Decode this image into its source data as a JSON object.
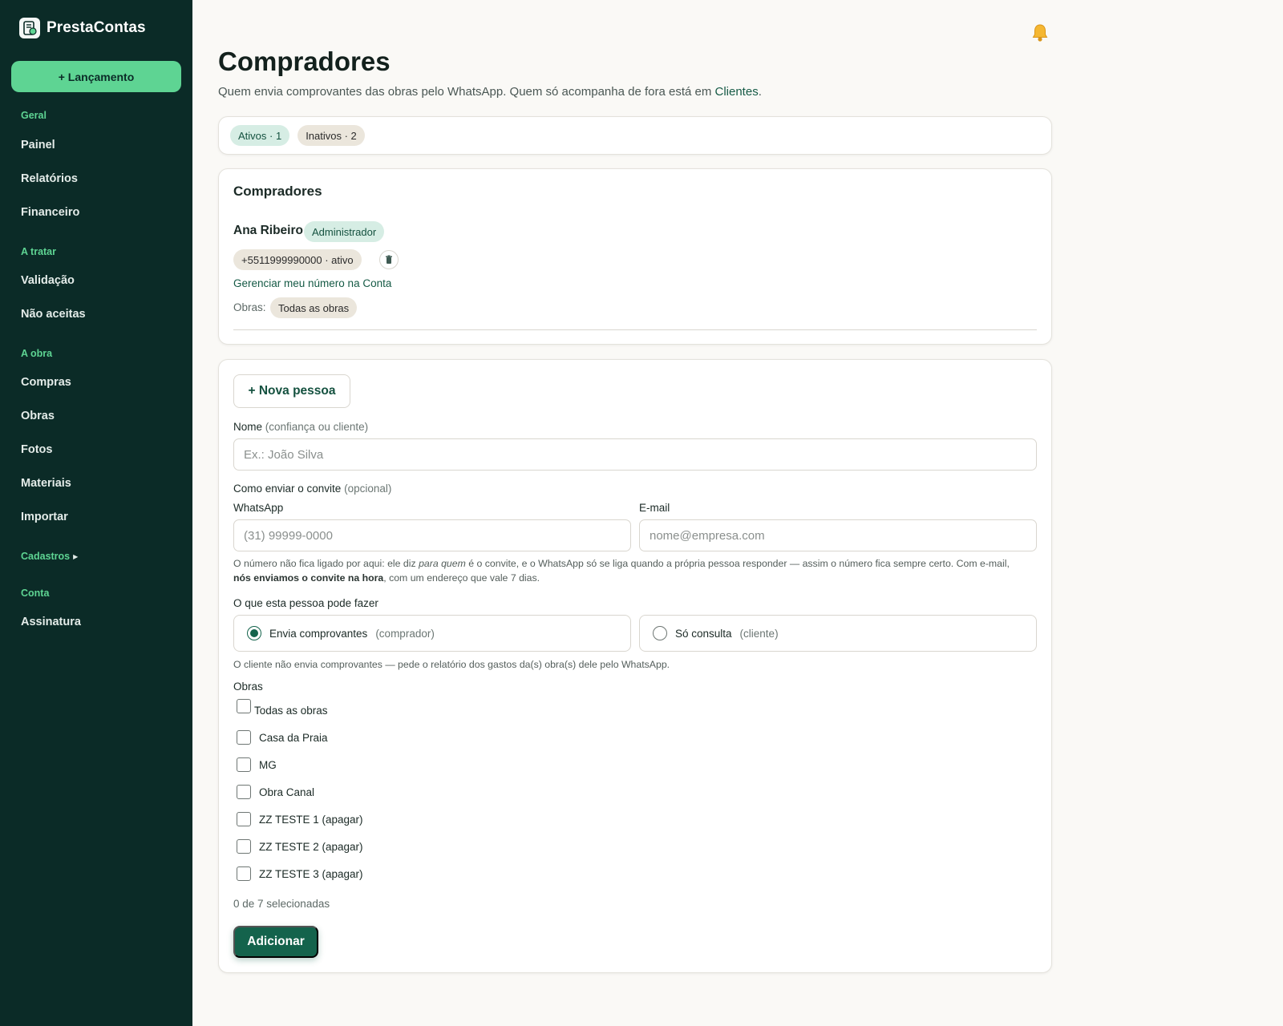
{
  "sidebar": {
    "brand": "PrestaContas",
    "launch_button": "+ Lançamento",
    "sections": {
      "geral": "Geral",
      "a_tratar": "A tratar",
      "a_obra": "A obra",
      "cadastros": "Cadastros",
      "conta": "Conta"
    },
    "items": {
      "painel": "Painel",
      "relatorios": "Relatórios",
      "financeiro": "Financeiro",
      "validacao": "Validação",
      "nao_aceitas": "Não aceitas",
      "compras": "Compras",
      "obras": "Obras",
      "fotos": "Fotos",
      "materiais": "Materiais",
      "importar": "Importar",
      "assinatura": "Assinatura"
    },
    "colors": {
      "background": "#0b2b27",
      "accent": "#5ed493"
    }
  },
  "header": {
    "title": "Compradores",
    "subtitle_text": "Quem envia comprovantes das obras pelo WhatsApp. Quem só acompanha de fora está em ",
    "subtitle_link": "Clientes",
    "subtitle_end": ".",
    "bell_icon": "bell-icon"
  },
  "filters": {
    "active": "Ativos · 1",
    "inactive": "Inativos · 2"
  },
  "list": {
    "title": "Compradores",
    "person": {
      "name": "Ana Ribeiro",
      "role": "Administrador",
      "phone": "+5511999990000 · ativo",
      "manage_link": "Gerenciar meu número na Conta",
      "obras_label": "Obras:",
      "obras_value": "Todas as obras"
    }
  },
  "form": {
    "new_button": "+ Nova pessoa",
    "name_label": "Nome",
    "name_hint": "(confiança ou cliente)",
    "name_placeholder": "Ex.: João Silva",
    "invite_label": "Como enviar o convite",
    "invite_hint": "(opcional)",
    "whatsapp_label": "WhatsApp",
    "whatsapp_placeholder": "(31) 99999-0000",
    "email_label": "E-mail",
    "email_placeholder": "nome@empresa.com",
    "help_1": "O número não fica ligado por aqui: ele diz ",
    "help_em": "para quem",
    "help_2": " é o convite, e o WhatsApp só se liga quando a própria pessoa responder — assim o número fica sempre certo. Com e-mail, ",
    "help_bold": "nós enviamos o convite na hora",
    "help_3": ", com um endereço que vale 7 dias.",
    "permission_label": "O que esta pessoa pode fazer",
    "option_buyer": "Envia comprovantes",
    "option_buyer_hint": "(comprador)",
    "option_client": "Só consulta",
    "option_client_hint": "(cliente)",
    "permission_help": "O cliente não envia comprovantes — pede o relatório dos gastos da(s) obra(s) dele pelo WhatsApp.",
    "obras_label": "Obras",
    "obras_options": [
      "Todas as obras",
      "Casa da Praia",
      "MG",
      "Obra Canal",
      "ZZ TESTE 1 (apagar)",
      "ZZ TESTE 2 (apagar)",
      "ZZ TESTE 3 (apagar)"
    ],
    "selected_count": "0 de 7 selecionadas",
    "submit": "Adicionar"
  }
}
